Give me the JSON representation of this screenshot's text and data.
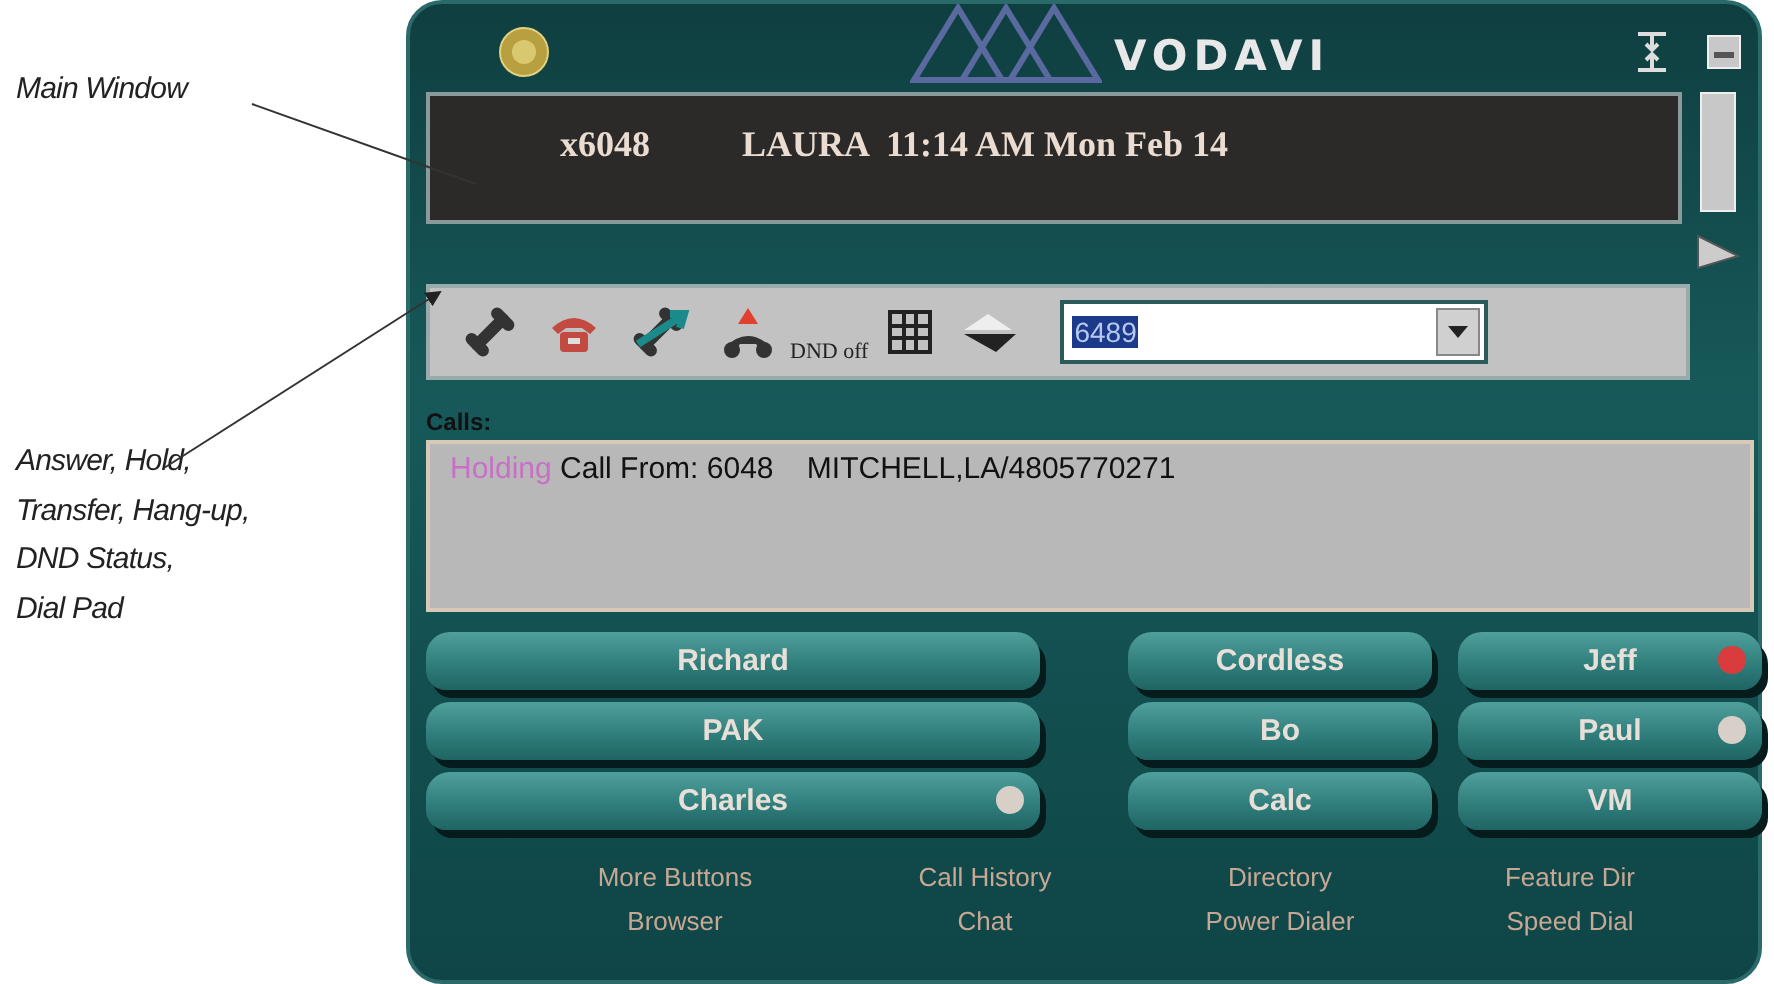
{
  "annotations": [
    {
      "kind": "main",
      "text": "Main Window"
    },
    {
      "kind": "toolbar",
      "lines": [
        "Answer, Hold,",
        "Transfer, Hang-up,",
        "DND Status,",
        "Dial Pad"
      ]
    }
  ],
  "window": {
    "logo_text": "VODAVI",
    "display": {
      "extension": "x6048",
      "info": "LAURA  11:14 AM Mon Feb 14"
    },
    "toolbar": {
      "dnd_status": "DND off",
      "dial_value": "6489"
    },
    "calls_label": "Calls:",
    "calls": [
      {
        "status": "Holding",
        "text": "Call From: 6048    MITCHELL,LA/4805770271"
      }
    ],
    "buttons": [
      {
        "label": "Richard",
        "kind": "wide"
      },
      {
        "label": "Cordless",
        "kind": "narrow"
      },
      {
        "label": "Jeff",
        "kind": "narrow",
        "color": "#d83c3c"
      },
      {
        "label": "PAK",
        "kind": "wide"
      },
      {
        "label": "Bo",
        "kind": "narrow"
      },
      {
        "label": "Paul",
        "kind": "narrow",
        "color": "#d8d0c8"
      },
      {
        "label": "Charles",
        "kind": "wide",
        "color": "#d8d0c8"
      },
      {
        "label": "Calc",
        "kind": "narrow"
      },
      {
        "label": "VM",
        "kind": "narrow"
      }
    ],
    "links": [
      "More Buttons",
      "Call History",
      "Directory",
      "Feature Dir",
      "Browser",
      "Chat",
      "Power Dialer",
      "Speed Dial"
    ]
  }
}
